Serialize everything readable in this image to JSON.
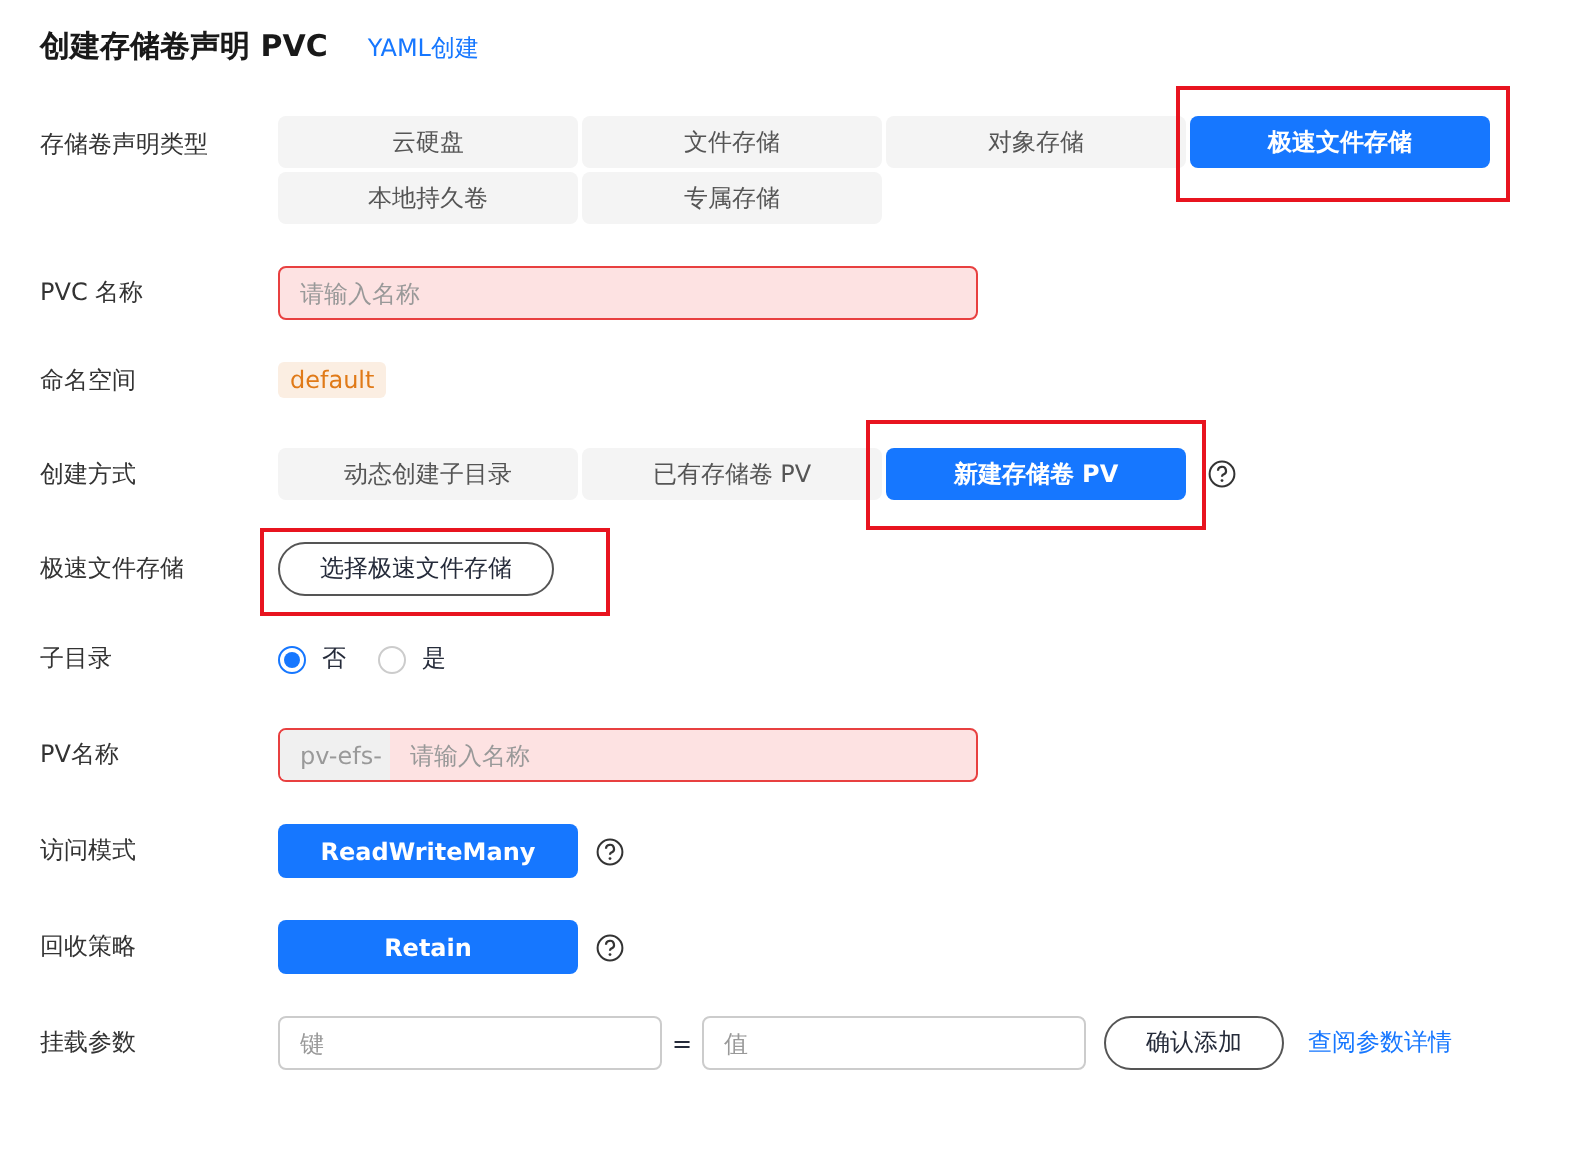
{
  "header": {
    "title": "创建存储卷声明 PVC",
    "link": "YAML创建"
  },
  "storage_type": {
    "label": "存储卷声明类型",
    "options": [
      {
        "label": "云硬盘",
        "selected": false,
        "highlighted": false
      },
      {
        "label": "文件存储",
        "selected": false,
        "highlighted": false
      },
      {
        "label": "对象存储",
        "selected": false,
        "highlighted": false
      },
      {
        "label": "极速文件存储",
        "selected": true,
        "highlighted": true
      },
      {
        "label": "本地持久卷",
        "selected": false,
        "highlighted": false
      },
      {
        "label": "专属存储",
        "selected": false,
        "highlighted": false
      }
    ]
  },
  "pvc_name": {
    "label": "PVC 名称",
    "placeholder": "请输入名称",
    "error": true
  },
  "namespace": {
    "label": "命名空间",
    "tag": "default"
  },
  "creation_method": {
    "label": "创建方式",
    "options": [
      {
        "label": "动态创建子目录",
        "selected": false,
        "highlighted": false
      },
      {
        "label": "已有存储卷 PV",
        "selected": false,
        "highlighted": false
      },
      {
        "label": "新建存储卷 PV",
        "selected": true,
        "highlighted": true
      }
    ]
  },
  "efs": {
    "label": "极速文件存储",
    "button": "选择极速文件存储",
    "highlighted": true
  },
  "subdirectory": {
    "label": "子目录",
    "options": [
      {
        "label": "否",
        "selected": true
      },
      {
        "label": "是",
        "selected": false
      }
    ]
  },
  "pv_name": {
    "label": "PV名称",
    "prefix": "pv-efs-",
    "placeholder": "请输入名称",
    "error": true
  },
  "access_mode": {
    "label": "访问模式",
    "value": "ReadWriteMany"
  },
  "reclaim_policy": {
    "label": "回收策略",
    "value": "Retain"
  },
  "mount_params": {
    "label": "挂载参数",
    "key_placeholder": "键",
    "separator": "=",
    "value_placeholder": "值",
    "button": "确认添加",
    "link": "查阅参数详情"
  }
}
